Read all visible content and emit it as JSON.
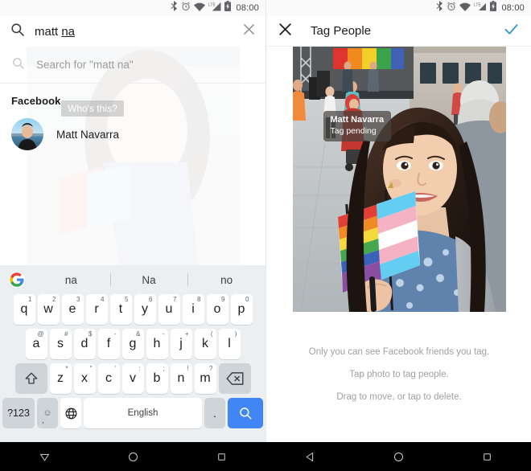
{
  "statusbar": {
    "time": "08:00",
    "icons": [
      "bluetooth-icon",
      "alarm-icon",
      "wifi-icon",
      "lte-signal-icon",
      "battery-icon"
    ]
  },
  "left_panel": {
    "search": {
      "icon": "search-icon",
      "value_prefix": "matt ",
      "value_composing": "na",
      "full_value": "matt na",
      "clear_icon": "close-icon"
    },
    "suggestion_row": {
      "icon": "search-icon",
      "label": "Search for \"matt na\""
    },
    "section_header": "Facebook",
    "person": {
      "name": "Matt Navarra",
      "avatar": "user-avatar"
    },
    "overlay_hint": "Who's this?"
  },
  "keyboard": {
    "logo": "google-g-icon",
    "suggestions": [
      "na",
      "Na",
      "no"
    ],
    "row1": [
      {
        "k": "q",
        "sup": "1"
      },
      {
        "k": "w",
        "sup": "2"
      },
      {
        "k": "e",
        "sup": "3"
      },
      {
        "k": "r",
        "sup": "4"
      },
      {
        "k": "t",
        "sup": "5"
      },
      {
        "k": "y",
        "sup": "6"
      },
      {
        "k": "u",
        "sup": "7"
      },
      {
        "k": "i",
        "sup": "8"
      },
      {
        "k": "o",
        "sup": "9"
      },
      {
        "k": "p",
        "sup": "0"
      }
    ],
    "row2": [
      {
        "k": "a",
        "sup": "@"
      },
      {
        "k": "s",
        "sup": "#"
      },
      {
        "k": "d",
        "sup": "$"
      },
      {
        "k": "f",
        "sup": "-"
      },
      {
        "k": "g",
        "sup": "&"
      },
      {
        "k": "h",
        "sup": "-"
      },
      {
        "k": "j",
        "sup": "+"
      },
      {
        "k": "k",
        "sup": "("
      },
      {
        "k": "l",
        "sup": ")"
      }
    ],
    "row3": [
      {
        "k": "z",
        "sup": "*"
      },
      {
        "k": "x",
        "sup": "\""
      },
      {
        "k": "c",
        "sup": "'"
      },
      {
        "k": "v",
        "sup": ":"
      },
      {
        "k": "b",
        "sup": ";"
      },
      {
        "k": "n",
        "sup": "!"
      },
      {
        "k": "m",
        "sup": "?"
      }
    ],
    "shift_icon": "shift-icon",
    "backspace_icon": "backspace-icon",
    "numeric_label": "?123",
    "emoji_icon": "emoji-icon",
    "comma_label": ",",
    "globe_icon": "globe-icon",
    "space_label": "English",
    "period_label": ".",
    "enter_icon": "search-icon"
  },
  "right_panel": {
    "header": {
      "close_icon": "close-icon",
      "title": "Tag People",
      "confirm_icon": "check-icon"
    },
    "photo_tag": {
      "name": "Matt Navarra",
      "status": "Tag pending"
    },
    "hints": [
      "Only you can see Facebook friends you tag.",
      "Tap photo to tag people.",
      "Drag to move, or tap to delete."
    ]
  },
  "navbar_left": [
    "keyboard-hide-icon",
    "home-icon",
    "recents-icon"
  ],
  "navbar_right": [
    "back-icon",
    "home-icon",
    "recents-icon"
  ],
  "colors": {
    "accent_blue": "#4285f4",
    "confirm_blue": "#3897d3",
    "keyboard_bg": "#eceff1",
    "key_fn": "#cfd4d8"
  }
}
